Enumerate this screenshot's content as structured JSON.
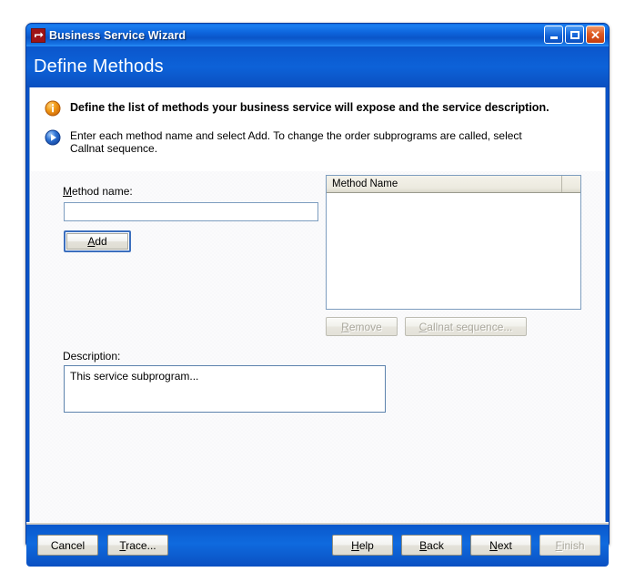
{
  "window": {
    "title": "Business Service Wizard",
    "app_icon": "callnat-arrow-icon",
    "controls": {
      "minimize": "minimize-icon",
      "maximize": "maximize-icon",
      "close": "close-icon"
    }
  },
  "banner": {
    "heading": "Define Methods"
  },
  "instructions": {
    "info_icon": "info-circle-icon",
    "info_text": "Define the list of methods your business service will expose and the service description.",
    "hint_icon": "arrow-circle-icon",
    "hint_text": "Enter each method name and select Add. To change the order subprograms are called, select Callnat sequence."
  },
  "form": {
    "method_name_label_pre": "",
    "method_name_label_mn": "M",
    "method_name_label_post": "ethod name:",
    "method_name_value": "",
    "method_name_placeholder": "",
    "add_button_mn": "A",
    "add_button_post": "dd",
    "description_label": "Description:",
    "description_value": "This service subprogram..."
  },
  "method_list": {
    "column_header": "Method Name",
    "rows": [],
    "remove_button_mn": "R",
    "remove_button_post": "emove",
    "remove_enabled": false,
    "callnat_button_mn": "C",
    "callnat_button_post": "allnat sequence...",
    "callnat_enabled": false
  },
  "footer": {
    "cancel_label": "Cancel",
    "trace_label_mn": "T",
    "trace_label_post": "race...",
    "help_label_mn": "H",
    "help_label_post": "elp",
    "back_label_mn": "B",
    "back_label_post": "ack",
    "next_label_mn": "N",
    "next_label_post": "ext",
    "finish_label_mn": "F",
    "finish_label_post": "inish",
    "finish_enabled": false
  },
  "colors": {
    "title_blue": "#0d64dc",
    "banner_blue": "#0b56cc",
    "footer_blue": "#0f6ade",
    "info_orange": "#e8820c",
    "hint_blue": "#2b6fd0",
    "field_border": "#7d9dbf",
    "disabled_text": "#aaa89d"
  }
}
